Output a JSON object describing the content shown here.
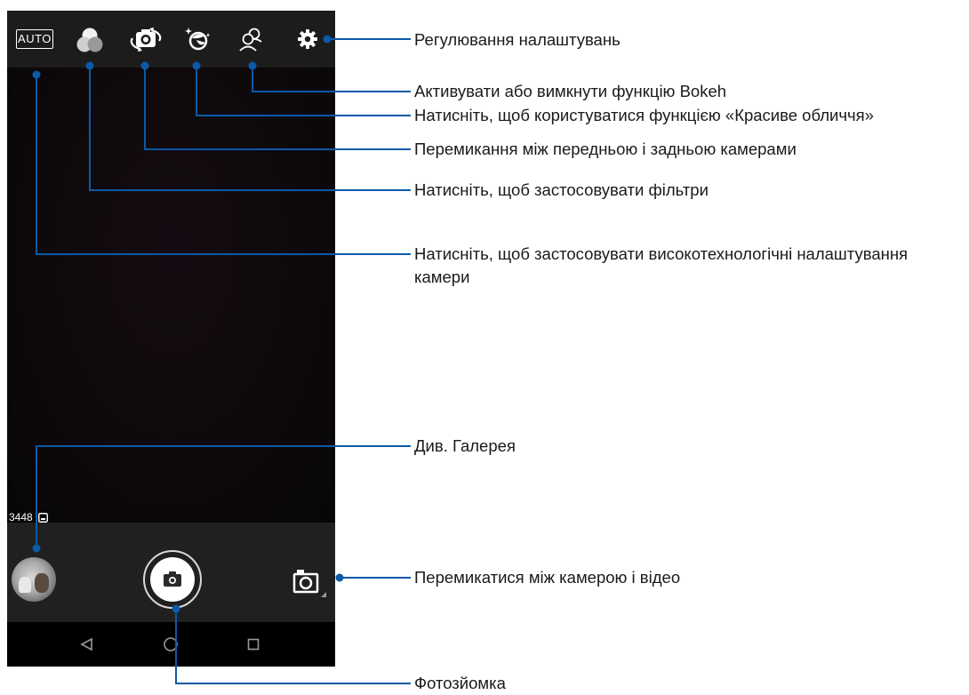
{
  "camera": {
    "mode_badge": "AUTO",
    "resolution_readout": "3448",
    "toolbar_icons": [
      "auto-mode-icon",
      "filters-icon",
      "switch-camera-icon",
      "beautification-icon",
      "bokeh-icon",
      "settings-gear-icon"
    ],
    "nav_icons": [
      "back-icon",
      "home-icon",
      "recents-icon"
    ],
    "accent_color": "#0a5aa8"
  },
  "callouts": [
    {
      "id": "settings",
      "text": "Регулювання налаштувань"
    },
    {
      "id": "bokeh",
      "text": "Активувати або вимкнути функцію Bokeh"
    },
    {
      "id": "beauty",
      "text": "Натисніть, щоб користуватися функцією «Красиве обличчя»"
    },
    {
      "id": "switch",
      "text": "Перемикання між передньою і задньою камерами"
    },
    {
      "id": "filters",
      "text": "Натисніть, щоб застосовувати фільтри"
    },
    {
      "id": "advanced",
      "text": "Натисніть, щоб застосовувати високотехнологічні налаштування камери"
    },
    {
      "id": "gallery",
      "text": "Див. Галерея"
    },
    {
      "id": "video",
      "text": "Перемикатися між камерою і відео"
    },
    {
      "id": "shoot",
      "text": "Фотозйомка"
    }
  ]
}
